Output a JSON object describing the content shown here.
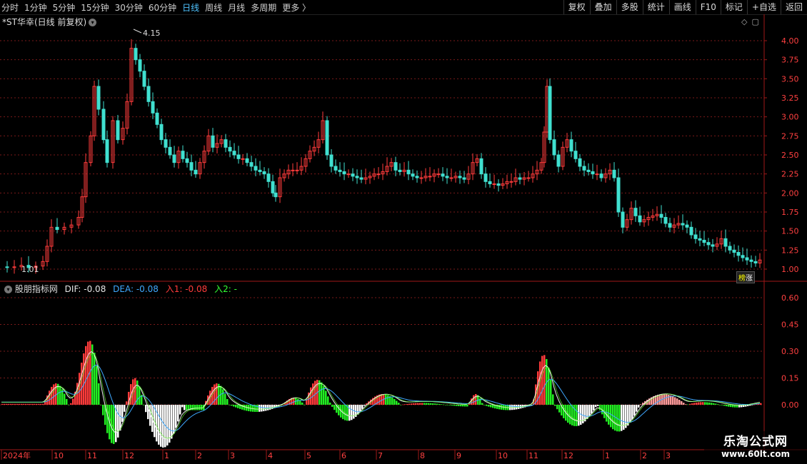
{
  "toolbar": {
    "periods": [
      "分时",
      "1分钟",
      "5分钟",
      "15分钟",
      "30分钟",
      "60分钟",
      "日线",
      "周线",
      "月线",
      "多周期",
      "更多 〉"
    ],
    "active_period": "日线",
    "right_buttons": [
      "复权",
      "叠加",
      "多股",
      "统计",
      "画线",
      "F10",
      "标记",
      "+自选",
      "返回"
    ]
  },
  "main_chart": {
    "title": "*ST华幸(日线 前复权)",
    "y_ticks": [
      "4.00",
      "3.75",
      "3.50",
      "3.25",
      "3.00",
      "2.75",
      "2.50",
      "2.25",
      "2.00",
      "1.75",
      "1.50",
      "1.25",
      "1.00"
    ],
    "high_label": "4.15",
    "low_label": "1.01",
    "corner_icons": [
      "◇",
      "▢"
    ]
  },
  "badge": {
    "left": "榜",
    "right": "涨"
  },
  "indicator": {
    "name": "股朋指标网",
    "dif_label": "DIF: -0.08",
    "dea_label": "DEA: -0.08",
    "in1_label": "入1: -0.08",
    "in2_label": "入2: -",
    "y_ticks": [
      "0.60",
      "0.45",
      "0.30",
      "0.15",
      "0.00"
    ]
  },
  "time_axis": {
    "labels": [
      "2024年",
      "10",
      "11",
      "12",
      "1",
      "2",
      "3",
      "4",
      "5",
      "6",
      "7",
      "8",
      "9",
      "10",
      "11",
      "12",
      "1",
      "2",
      "3"
    ]
  },
  "watermark": {
    "line1": "乐淘公式网",
    "line2": "www.60lt.com"
  },
  "colors": {
    "up": "#ff3b3b",
    "down": "#40e0d0",
    "dea": "#3fa9ff",
    "dif": "#ffffff",
    "green": "#22ee22",
    "grid": "#7a1a1a"
  }
}
